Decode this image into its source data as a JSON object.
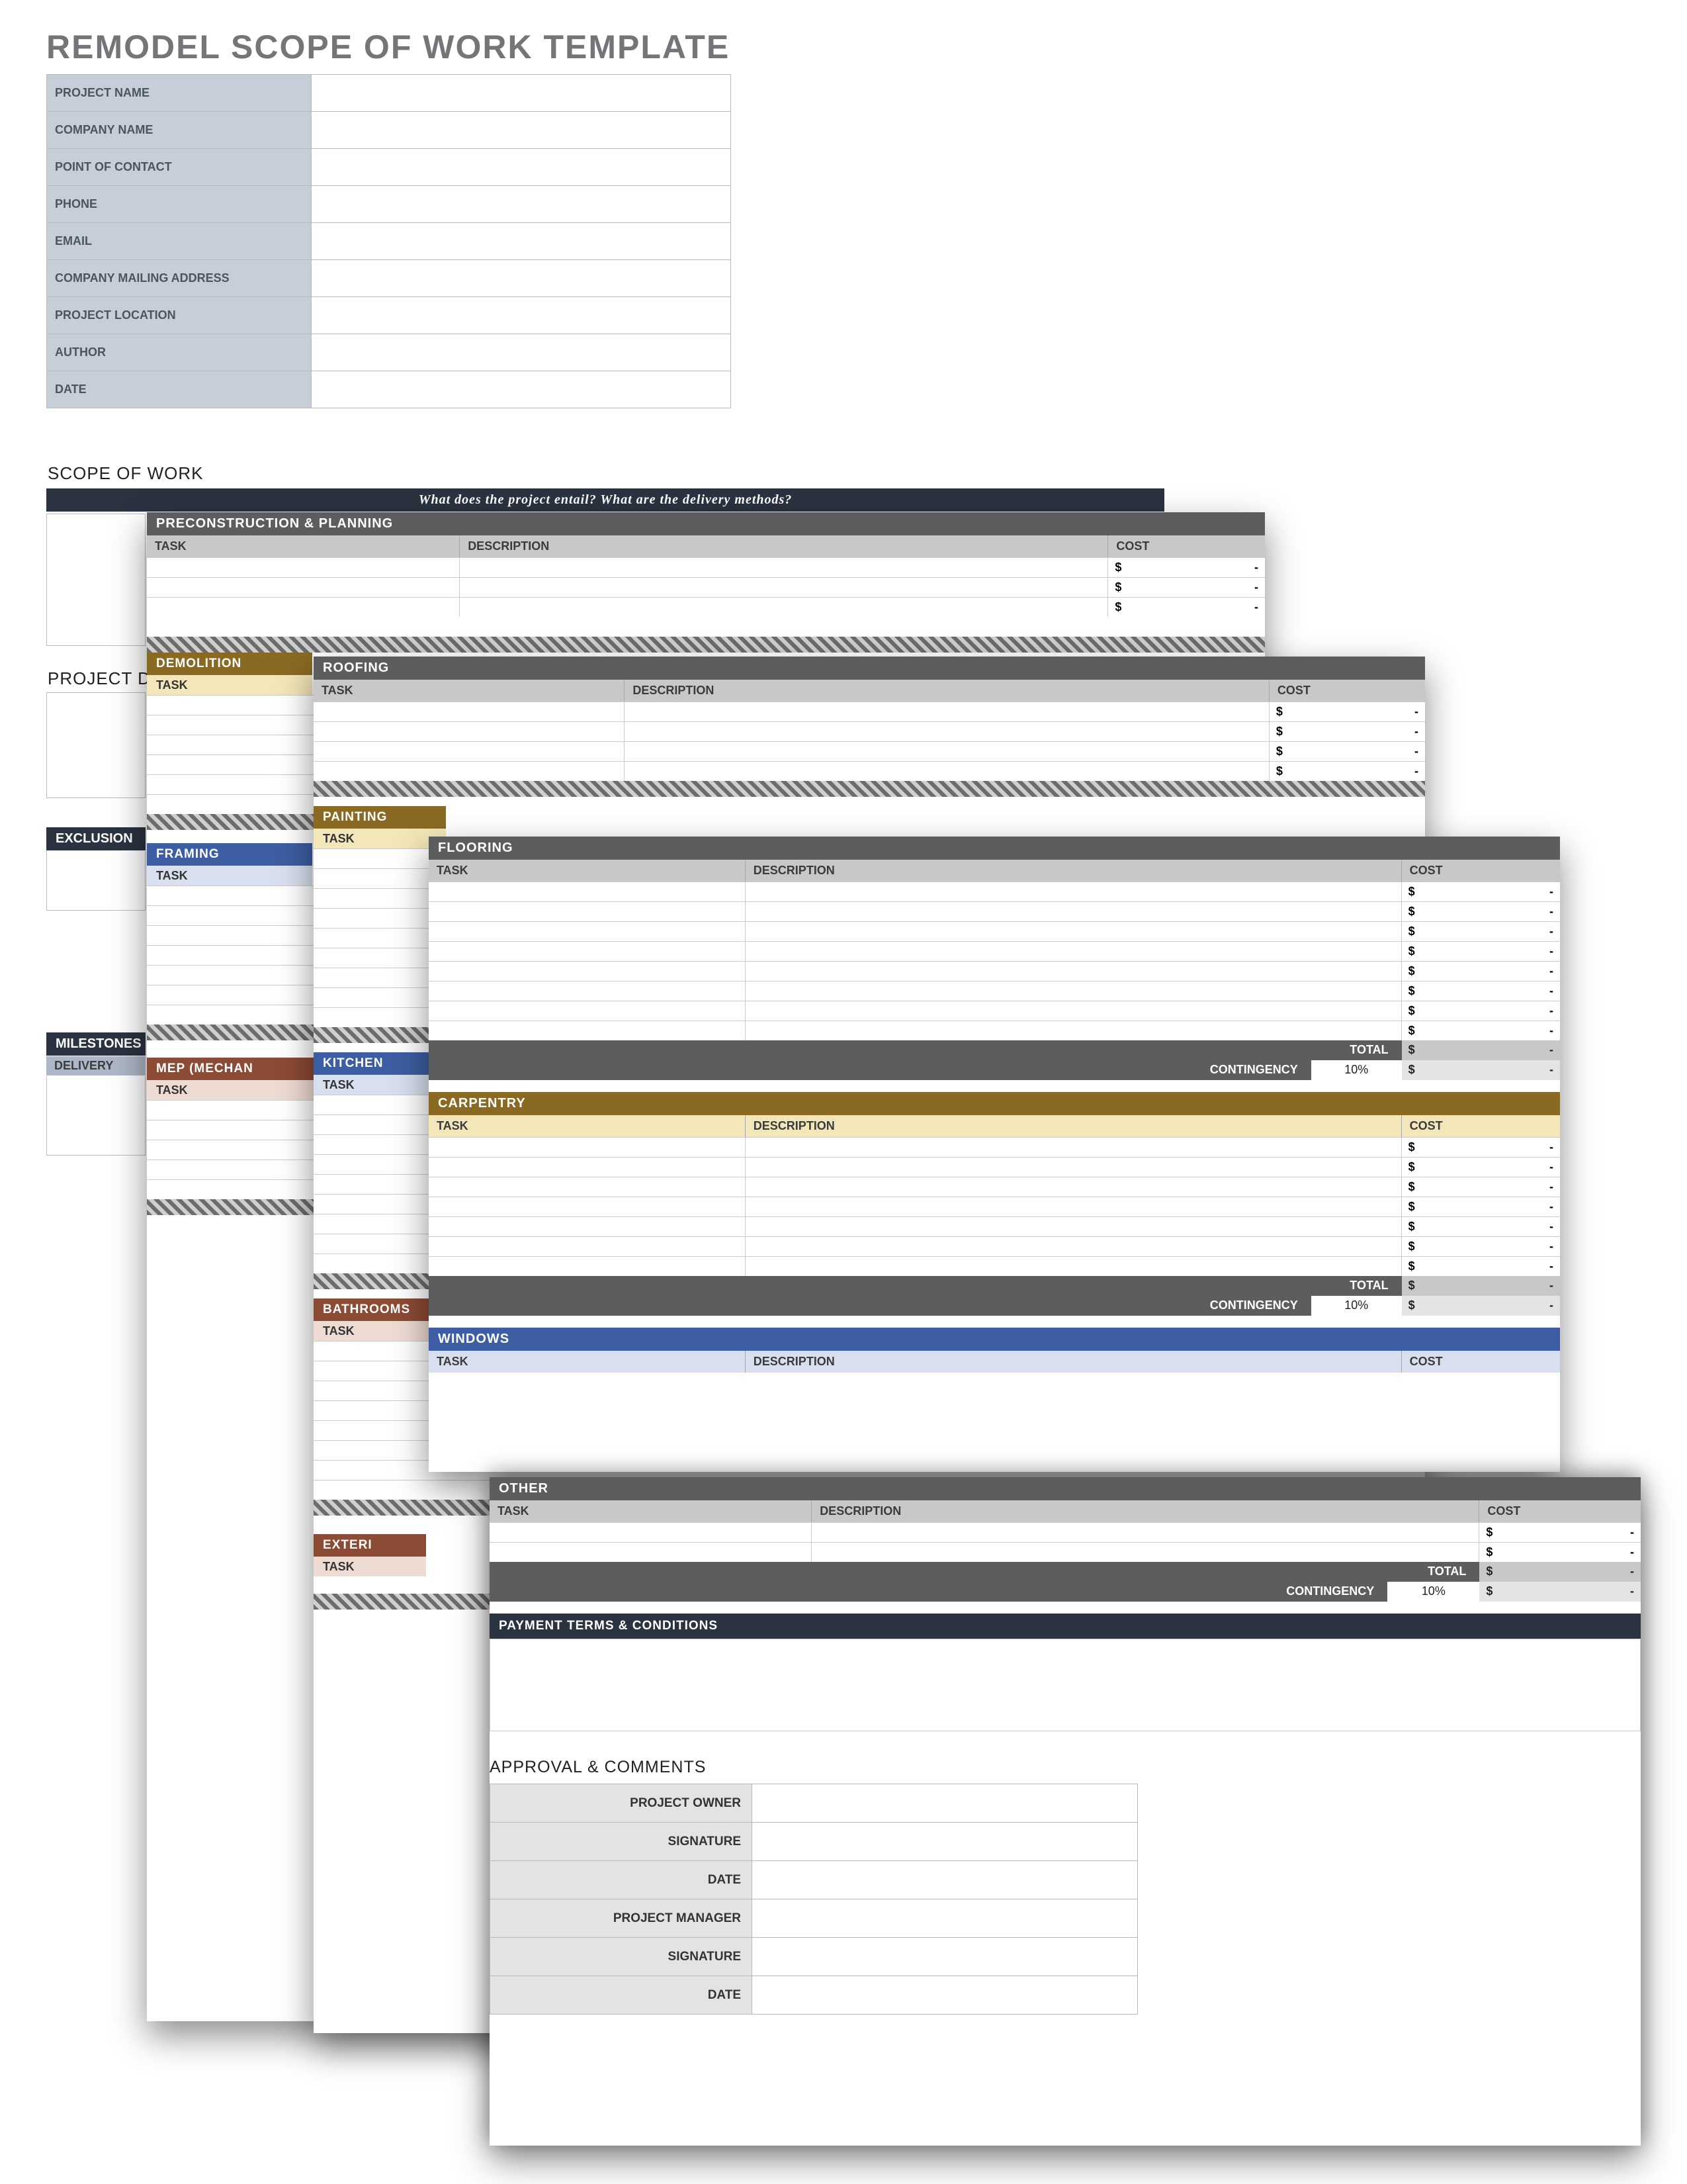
{
  "title": "REMODEL SCOPE OF WORK TEMPLATE",
  "info_fields": [
    {
      "label": "PROJECT NAME",
      "value": ""
    },
    {
      "label": "COMPANY NAME",
      "value": ""
    },
    {
      "label": "POINT OF CONTACT",
      "value": ""
    },
    {
      "label": "PHONE",
      "value": ""
    },
    {
      "label": "EMAIL",
      "value": ""
    },
    {
      "label": "COMPANY MAILING ADDRESS",
      "value": ""
    },
    {
      "label": "PROJECT LOCATION",
      "value": ""
    },
    {
      "label": "AUTHOR",
      "value": ""
    },
    {
      "label": "DATE",
      "value": ""
    }
  ],
  "base": {
    "scope_heading": "SCOPE OF WORK",
    "scope_prompt": "What does the project entail?  What are the delivery methods?",
    "project_del_heading": "PROJECT DEL",
    "exclusions_band": "EXCLUSION",
    "milestones_band": "MILESTONES",
    "milestones_sub": "DELIVERY"
  },
  "columns": {
    "task": "TASK",
    "description": "DESCRIPTION",
    "cost": "COST"
  },
  "main_sections": {
    "preconstruction": "PRECONSTRUCTION & PLANNING",
    "roofing": "ROOFING",
    "flooring": "FLOORING",
    "carpentry": "CARPENTRY",
    "windows": "WINDOWS",
    "other": "OTHER",
    "payment": "PAYMENT TERMS & CONDITIONS"
  },
  "sub_sections": {
    "demolition": {
      "label": "DEMOLITION",
      "color": "#8a6a23",
      "tint": "#f3e6b8"
    },
    "painting": {
      "label": "PAINTING",
      "color": "#8a6a23",
      "tint": "#f3e6b8"
    },
    "framing": {
      "label": "FRAMING",
      "color": "#3e5ea3",
      "tint": "#d8e0ef"
    },
    "kitchen": {
      "label": "KITCHEN",
      "color": "#3e5ea3",
      "tint": "#d8e0ef"
    },
    "mep": {
      "label": "MEP (MECHAN",
      "color": "#8c4b34",
      "tint": "#eedcd3"
    },
    "bathrooms": {
      "label": "BATHROOMS",
      "color": "#8c4b34",
      "tint": "#eedcd3"
    },
    "exterior": {
      "label": "EXTERI",
      "color": "#8c4b34",
      "tint": "#eedcd3"
    }
  },
  "money": {
    "symbol": "$",
    "dash": "-",
    "total": "TOTAL",
    "contingency": "CONTINGENCY",
    "pct": "10%"
  },
  "approval": {
    "title": "APPROVAL & COMMENTS",
    "fields": [
      "PROJECT OWNER",
      "SIGNATURE",
      "DATE",
      "PROJECT MANAGER",
      "SIGNATURE",
      "DATE"
    ]
  }
}
